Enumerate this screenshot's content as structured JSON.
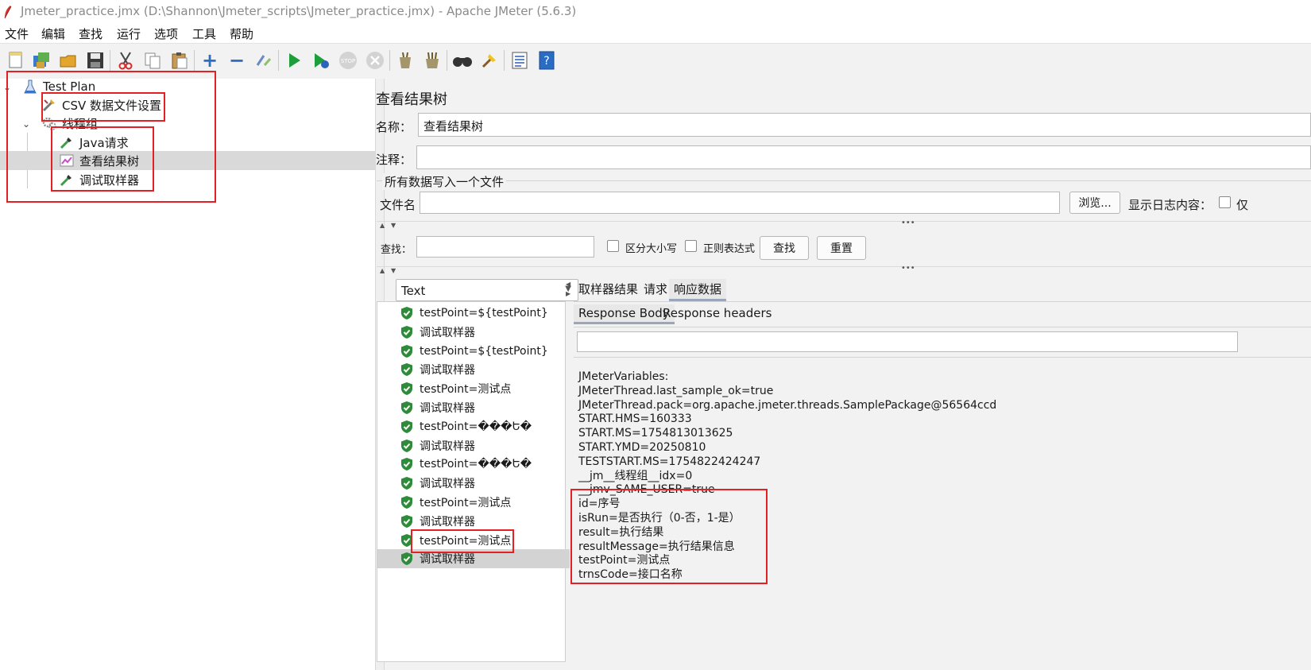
{
  "window": {
    "title": "Jmeter_practice.jmx (D:\\Shannon\\Jmeter_scripts\\Jmeter_practice.jmx) - Apache JMeter (5.6.3)"
  },
  "menu": [
    "文件",
    "编辑",
    "查找",
    "运行",
    "选项",
    "工具",
    "帮助"
  ],
  "toolbar_icons": [
    "new-icon",
    "templates-icon",
    "open-icon",
    "save-icon",
    "cut-icon",
    "copy-icon",
    "paste-icon",
    "expand-icon",
    "collapse-icon",
    "toggle-icon",
    "start-icon",
    "start-no-pause-icon",
    "stop-icon",
    "shutdown-icon",
    "clear-icon",
    "clear-all-icon",
    "search-icon",
    "reset-search-icon",
    "function-helper-icon",
    "help-icon"
  ],
  "tree": {
    "test_plan": "Test Plan",
    "csv": "CSV 数据文件设置",
    "thread_group": "线程组",
    "java_request": "Java请求",
    "view_results_tree": "查看结果树",
    "debug_sampler": "调试取样器"
  },
  "panel": {
    "title": "查看结果树",
    "name_label": "名称：",
    "name_value": "查看结果树",
    "comment_label": "注释：",
    "comment_value": "",
    "write_all_label": "所有数据写入一个文件",
    "filename_label": "文件名",
    "filename_value": "",
    "browse_button": "浏览...",
    "log_contents_label": "显示日志内容：",
    "only_label": "仅",
    "search_label": "查找：",
    "search_value": "",
    "case_sensitive_label": "区分大小写",
    "regex_label": "正则表达式",
    "find_button": "查找",
    "reset_button": "重置"
  },
  "renderer_select": {
    "selected": "Text"
  },
  "results": [
    "testPoint=${testPoint}",
    "调试取样器",
    "testPoint=${testPoint}",
    "调试取样器",
    "testPoint=测试点",
    "调试取样器",
    "testPoint=���Ե�",
    "调试取样器",
    "testPoint=���Ե�",
    "调试取样器",
    "testPoint=测试点",
    "调试取样器",
    "testPoint=测试点",
    "调试取样器"
  ],
  "tabs": {
    "sampler_result": "取样器结果",
    "request": "请求",
    "response_data": "响应数据"
  },
  "subtabs": {
    "response_body": "Response Body",
    "response_headers": "Response headers"
  },
  "response_body": [
    "JMeterVariables:",
    "JMeterThread.last_sample_ok=true",
    "JMeterThread.pack=org.apache.jmeter.threads.SamplePackage@56564ccd",
    "START.HMS=160333",
    "START.MS=1754813013625",
    "START.YMD=20250810",
    "TESTSTART.MS=1754822424247",
    "__jm__线程组__idx=0",
    "__jmv_SAME_USER=true",
    "id=序号",
    "isRun=是否执行（0-否，1-是）",
    "result=执行结果",
    "resultMessage=执行结果信息",
    "testPoint=测试点",
    "trnsCode=接口名称"
  ],
  "colors": {
    "highlight": "#e32124",
    "selection": "#d9d9d9",
    "shield_green": "#2e8b3a"
  }
}
